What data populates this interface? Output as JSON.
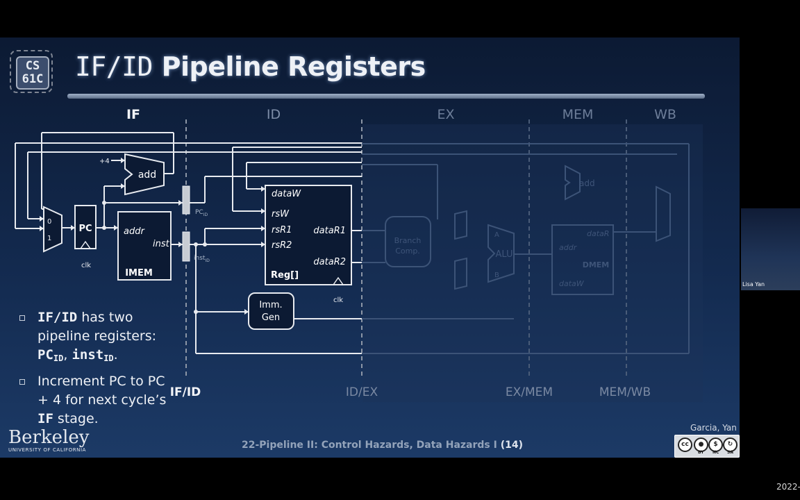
{
  "logo": {
    "line1": "CS",
    "line2": "61C"
  },
  "title": {
    "mono": "IF/ID",
    "rest": "Pipeline Registers"
  },
  "stages": {
    "if": "IF",
    "id": "ID",
    "ex": "EX",
    "mem": "MEM",
    "wb": "WB"
  },
  "boundaries": {
    "if_id": "IF/ID",
    "id_ex": "ID/EX",
    "ex_mem": "EX/MEM",
    "mem_wb": "MEM/WB"
  },
  "diagram": {
    "plus4": "+4",
    "add": "add",
    "add2": "add",
    "mux0": "0",
    "mux1": "1",
    "pc": "PC",
    "clk": "clk",
    "clk2": "clk",
    "addr": "addr",
    "inst": "inst",
    "imem": "IMEM",
    "pc_reg": "PC",
    "pc_reg_sub": "ID",
    "inst_reg": "inst",
    "inst_reg_sub": "ID",
    "dataW": "dataW",
    "rsW": "rsW",
    "rsR1": "rsR1",
    "rsR2": "rsR2",
    "dataR1": "dataR1",
    "dataR2": "dataR2",
    "reg": "Reg[]",
    "imm1": "Imm.",
    "imm2": "Gen",
    "branch1": "Branch",
    "branch2": "Comp.",
    "alu": "ALU",
    "a": "A",
    "b": "B",
    "mem_dataR": "dataR",
    "mem_addr": "addr",
    "mem_dataW": "dataW",
    "dmem": "DMEM"
  },
  "bullets": [
    {
      "mono1": "IF/ID",
      "t1": " has two pipeline registers: ",
      "r1": "PC",
      "r1sub": "ID",
      "sep": ", ",
      "r2": "inst",
      "r2sub": "ID",
      "end": "."
    },
    {
      "t1": "Increment PC to PC + 4 for next cycle’s ",
      "mono": "IF",
      "t2": " stage."
    }
  ],
  "footer": {
    "lecture": "22-Pipeline II: Control Hazards, Data Hazards I ",
    "page": "(14)"
  },
  "branding": {
    "university": "Berkeley",
    "university_sub": "UNIVERSITY OF CALIFORNIA",
    "authors": "Garcia, Yan"
  },
  "license": {
    "cc": "cc",
    "by": "BY",
    "nc": "NC",
    "sa": "SA"
  },
  "webcam": {
    "name": "Lisa Yan"
  },
  "timestamp": "2022-"
}
